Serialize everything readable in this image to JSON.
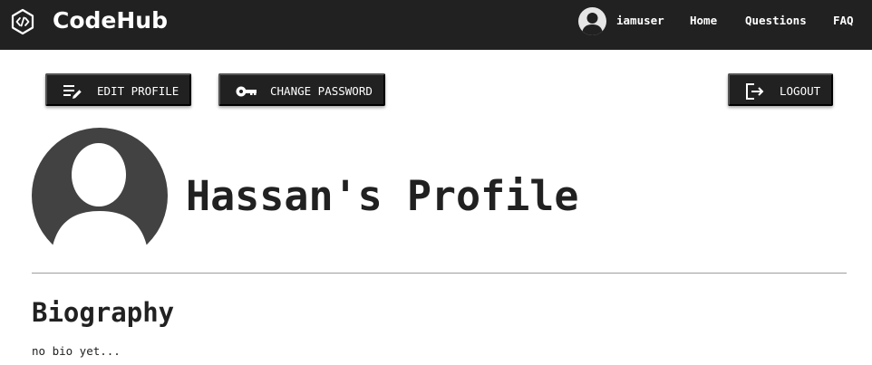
{
  "header": {
    "brand": "CodeHub",
    "username": "iamuser",
    "nav": {
      "home": "Home",
      "questions": "Questions",
      "faq": "FAQ"
    }
  },
  "actions": {
    "edit_profile": "EDIT PROFILE",
    "change_password": "CHANGE PASSWORD",
    "logout": "LOGOUT"
  },
  "profile": {
    "title": "Hassan's Profile",
    "biography_heading": "Biography",
    "biography_text": "no bio yet..."
  },
  "icons": {
    "logo": "code-hexagon-icon",
    "user_avatar": "user-avatar-icon",
    "edit": "edit-list-icon",
    "password": "key-icon",
    "logout": "logout-icon",
    "profile_avatar": "profile-avatar-icon"
  },
  "colors": {
    "header_bg": "#212121",
    "button_bg": "#212121",
    "avatar": "#424242",
    "divider": "#9e9e9e"
  }
}
